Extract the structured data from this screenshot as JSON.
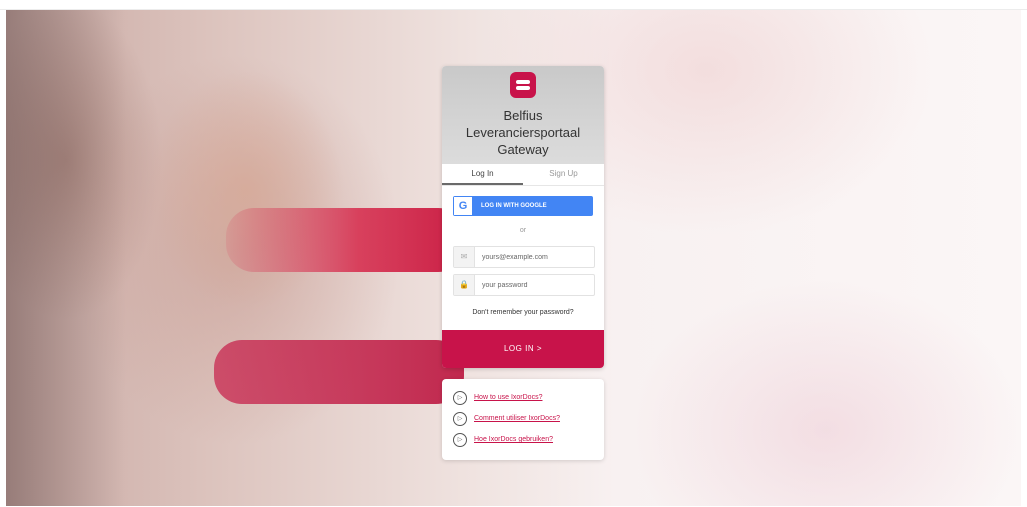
{
  "brand": {
    "name": "Belfius Leveranciersportaal Gateway",
    "accent": "#c8134a",
    "google_blue": "#4285f4"
  },
  "tabs": [
    {
      "label": "Log In",
      "active": true
    },
    {
      "label": "Sign Up",
      "active": false
    }
  ],
  "google_button": {
    "label": "LOG IN WITH GOOGLE",
    "icon": "google-g-icon"
  },
  "divider": "or",
  "email_field": {
    "placeholder": "yours@example.com",
    "value": "",
    "icon": "mail-icon"
  },
  "password_field": {
    "placeholder": "your password",
    "value": "",
    "icon": "lock-icon"
  },
  "forgot_password": "Don't remember your password?",
  "login_button": "LOG IN >",
  "help_links": [
    {
      "label": "How to use IxorDocs?",
      "icon": "play-icon"
    },
    {
      "label": "Comment utiliser IxorDocs?",
      "icon": "play-icon"
    },
    {
      "label": "Hoe IxorDocs gebruiken?",
      "icon": "play-icon"
    }
  ]
}
